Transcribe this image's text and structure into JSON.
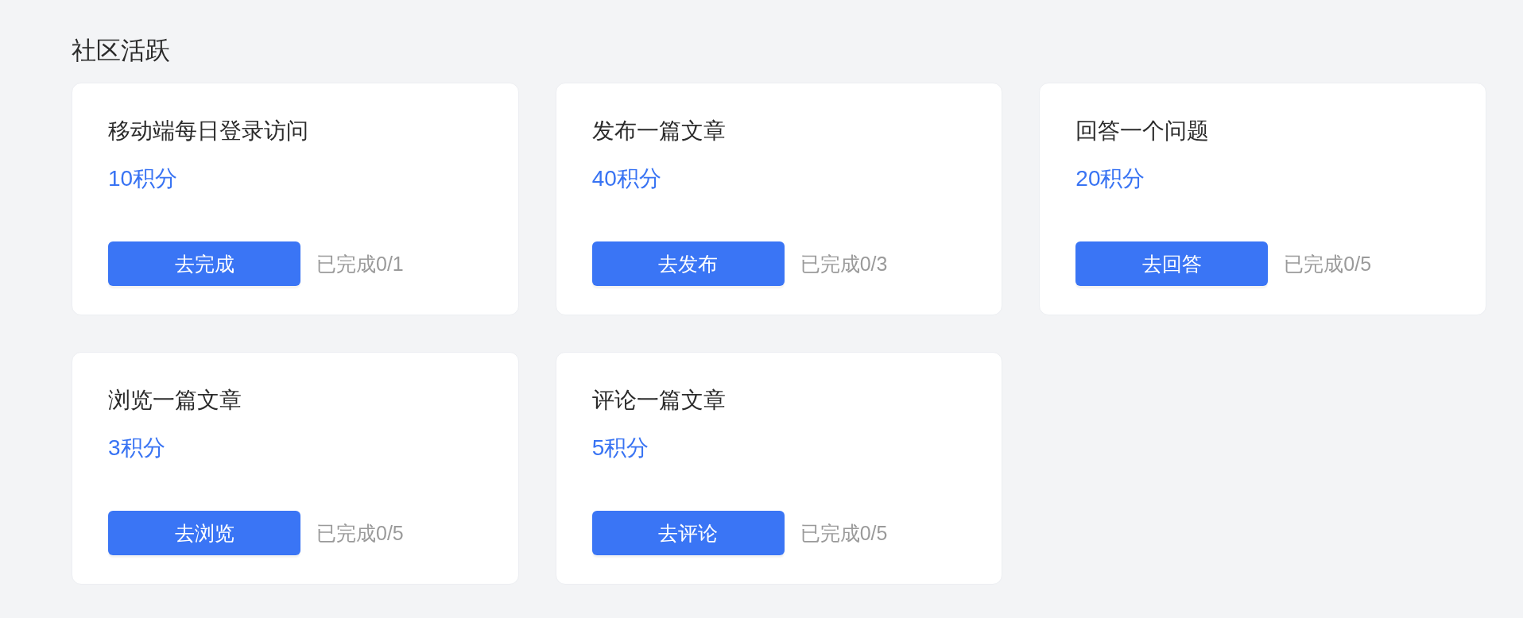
{
  "section": {
    "title": "社区活跃"
  },
  "tasks": [
    {
      "title": "移动端每日登录访问",
      "points": "10积分",
      "action": "去完成",
      "progress": "已完成0/1"
    },
    {
      "title": "发布一篇文章",
      "points": "40积分",
      "action": "去发布",
      "progress": "已完成0/3"
    },
    {
      "title": "回答一个问题",
      "points": "20积分",
      "action": "去回答",
      "progress": "已完成0/5"
    },
    {
      "title": "浏览一篇文章",
      "points": "3积分",
      "action": "去浏览",
      "progress": "已完成0/5"
    },
    {
      "title": "评论一篇文章",
      "points": "5积分",
      "action": "去评论",
      "progress": "已完成0/5"
    }
  ]
}
